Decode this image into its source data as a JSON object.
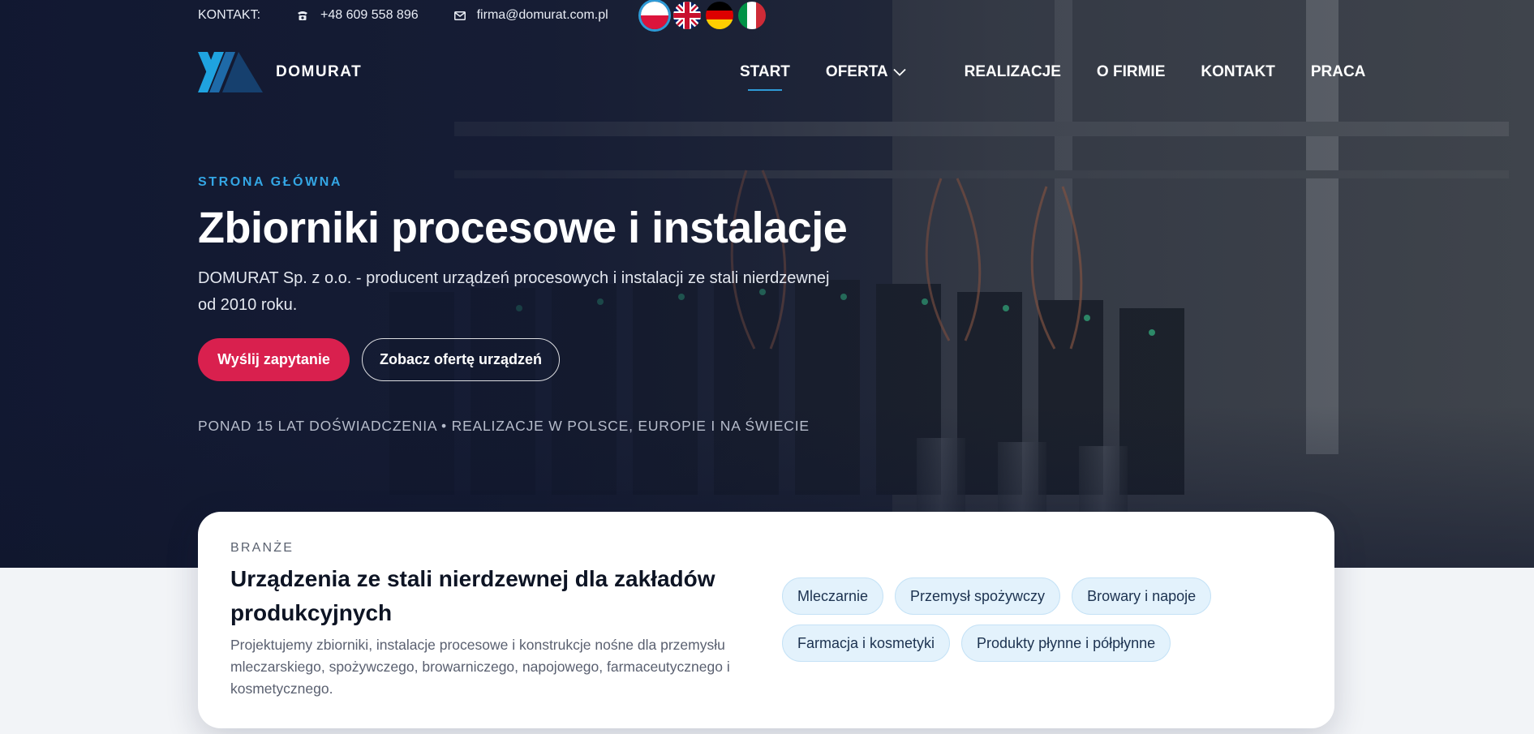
{
  "topbar": {
    "contact_label": "KONTAKT:",
    "phone": "+48 609 558 896",
    "email": "firma@domurat.com.pl",
    "flags": [
      {
        "name": "flag-poland-icon",
        "active": true
      },
      {
        "name": "flag-uk-icon",
        "active": false
      },
      {
        "name": "flag-germany-icon",
        "active": false
      },
      {
        "name": "flag-italy-icon",
        "active": false
      }
    ]
  },
  "brand": {
    "name": "DOMURAT",
    "logo_colors": [
      "#1fa3e0",
      "#1e6aa8",
      "#16406e"
    ]
  },
  "nav": {
    "items": [
      "START",
      "OFERTA",
      "REALIZACJE",
      "O FIRMIE",
      "KONTAKT",
      "PRACA"
    ],
    "active": "START"
  },
  "hero": {
    "eyebrow": "STRONA GŁÓWNA",
    "title": "Zbiorniki procesowe i instalacje",
    "lead": "DOMURAT Sp. z o.o. - producent urządzeń procesowych i instalacji ze stali nierdzewnej od 2010 roku.",
    "primary_button": "Wyślij zapytanie",
    "secondary_button": "Zobacz ofertę urządzeń",
    "tagline": "PONAD 15 LAT DOŚWIADCZENIA • REALIZACJE W POLSCE, EUROPIE I NA ŚWIECIE"
  },
  "industries": {
    "eyebrow": "BRANŻE",
    "title": "Urządzenia ze stali nierdzewnej dla zakładów produkcyjnych",
    "text": "Projektujemy zbiorniki, instalacje procesowe i konstrukcje nośne dla przemysłu mleczarskiego, spożywczego, browarniczego, napojowego, farmaceutycznego i kosmetycznego.",
    "chips": [
      "Mleczarnie",
      "Przemysł spożywczy",
      "Browary i napoje",
      "Farmacja i kosmetyki",
      "Produkty płynne i półpłynne"
    ]
  },
  "colors": {
    "accent_blue": "#2e9ad6",
    "primary_red": "#d9204e",
    "hero_dark": "#141b33"
  }
}
